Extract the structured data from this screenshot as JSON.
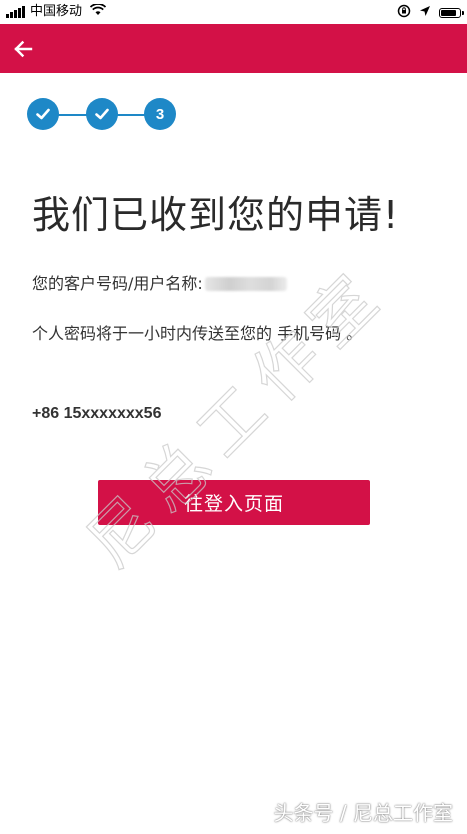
{
  "status_bar": {
    "carrier": "中国移动",
    "icons": [
      "signal-icon",
      "wifi-icon",
      "rotation-lock-icon",
      "location-icon",
      "battery-icon"
    ],
    "battery_level": 0.9
  },
  "app_bar": {
    "back_icon": "arrow-left-icon",
    "color": "#d31147"
  },
  "stepper": {
    "steps": [
      {
        "state": "done",
        "icon": "check-icon"
      },
      {
        "state": "done",
        "icon": "check-icon"
      },
      {
        "state": "current",
        "label": "3"
      }
    ],
    "color": "#1e88c7"
  },
  "content": {
    "title": "我们已收到您的申请!",
    "customer_label": "您的客户号码/用户名称:",
    "password_notice": "个人密码将于一小时内传送至您的 手机号码 。",
    "phone": "+86 15xxxxxxx56"
  },
  "login_button": {
    "label": "往登入页面"
  },
  "watermark": {
    "text": "尼总工作室"
  },
  "footer": {
    "text": "头条号 / 尼总工作室"
  }
}
